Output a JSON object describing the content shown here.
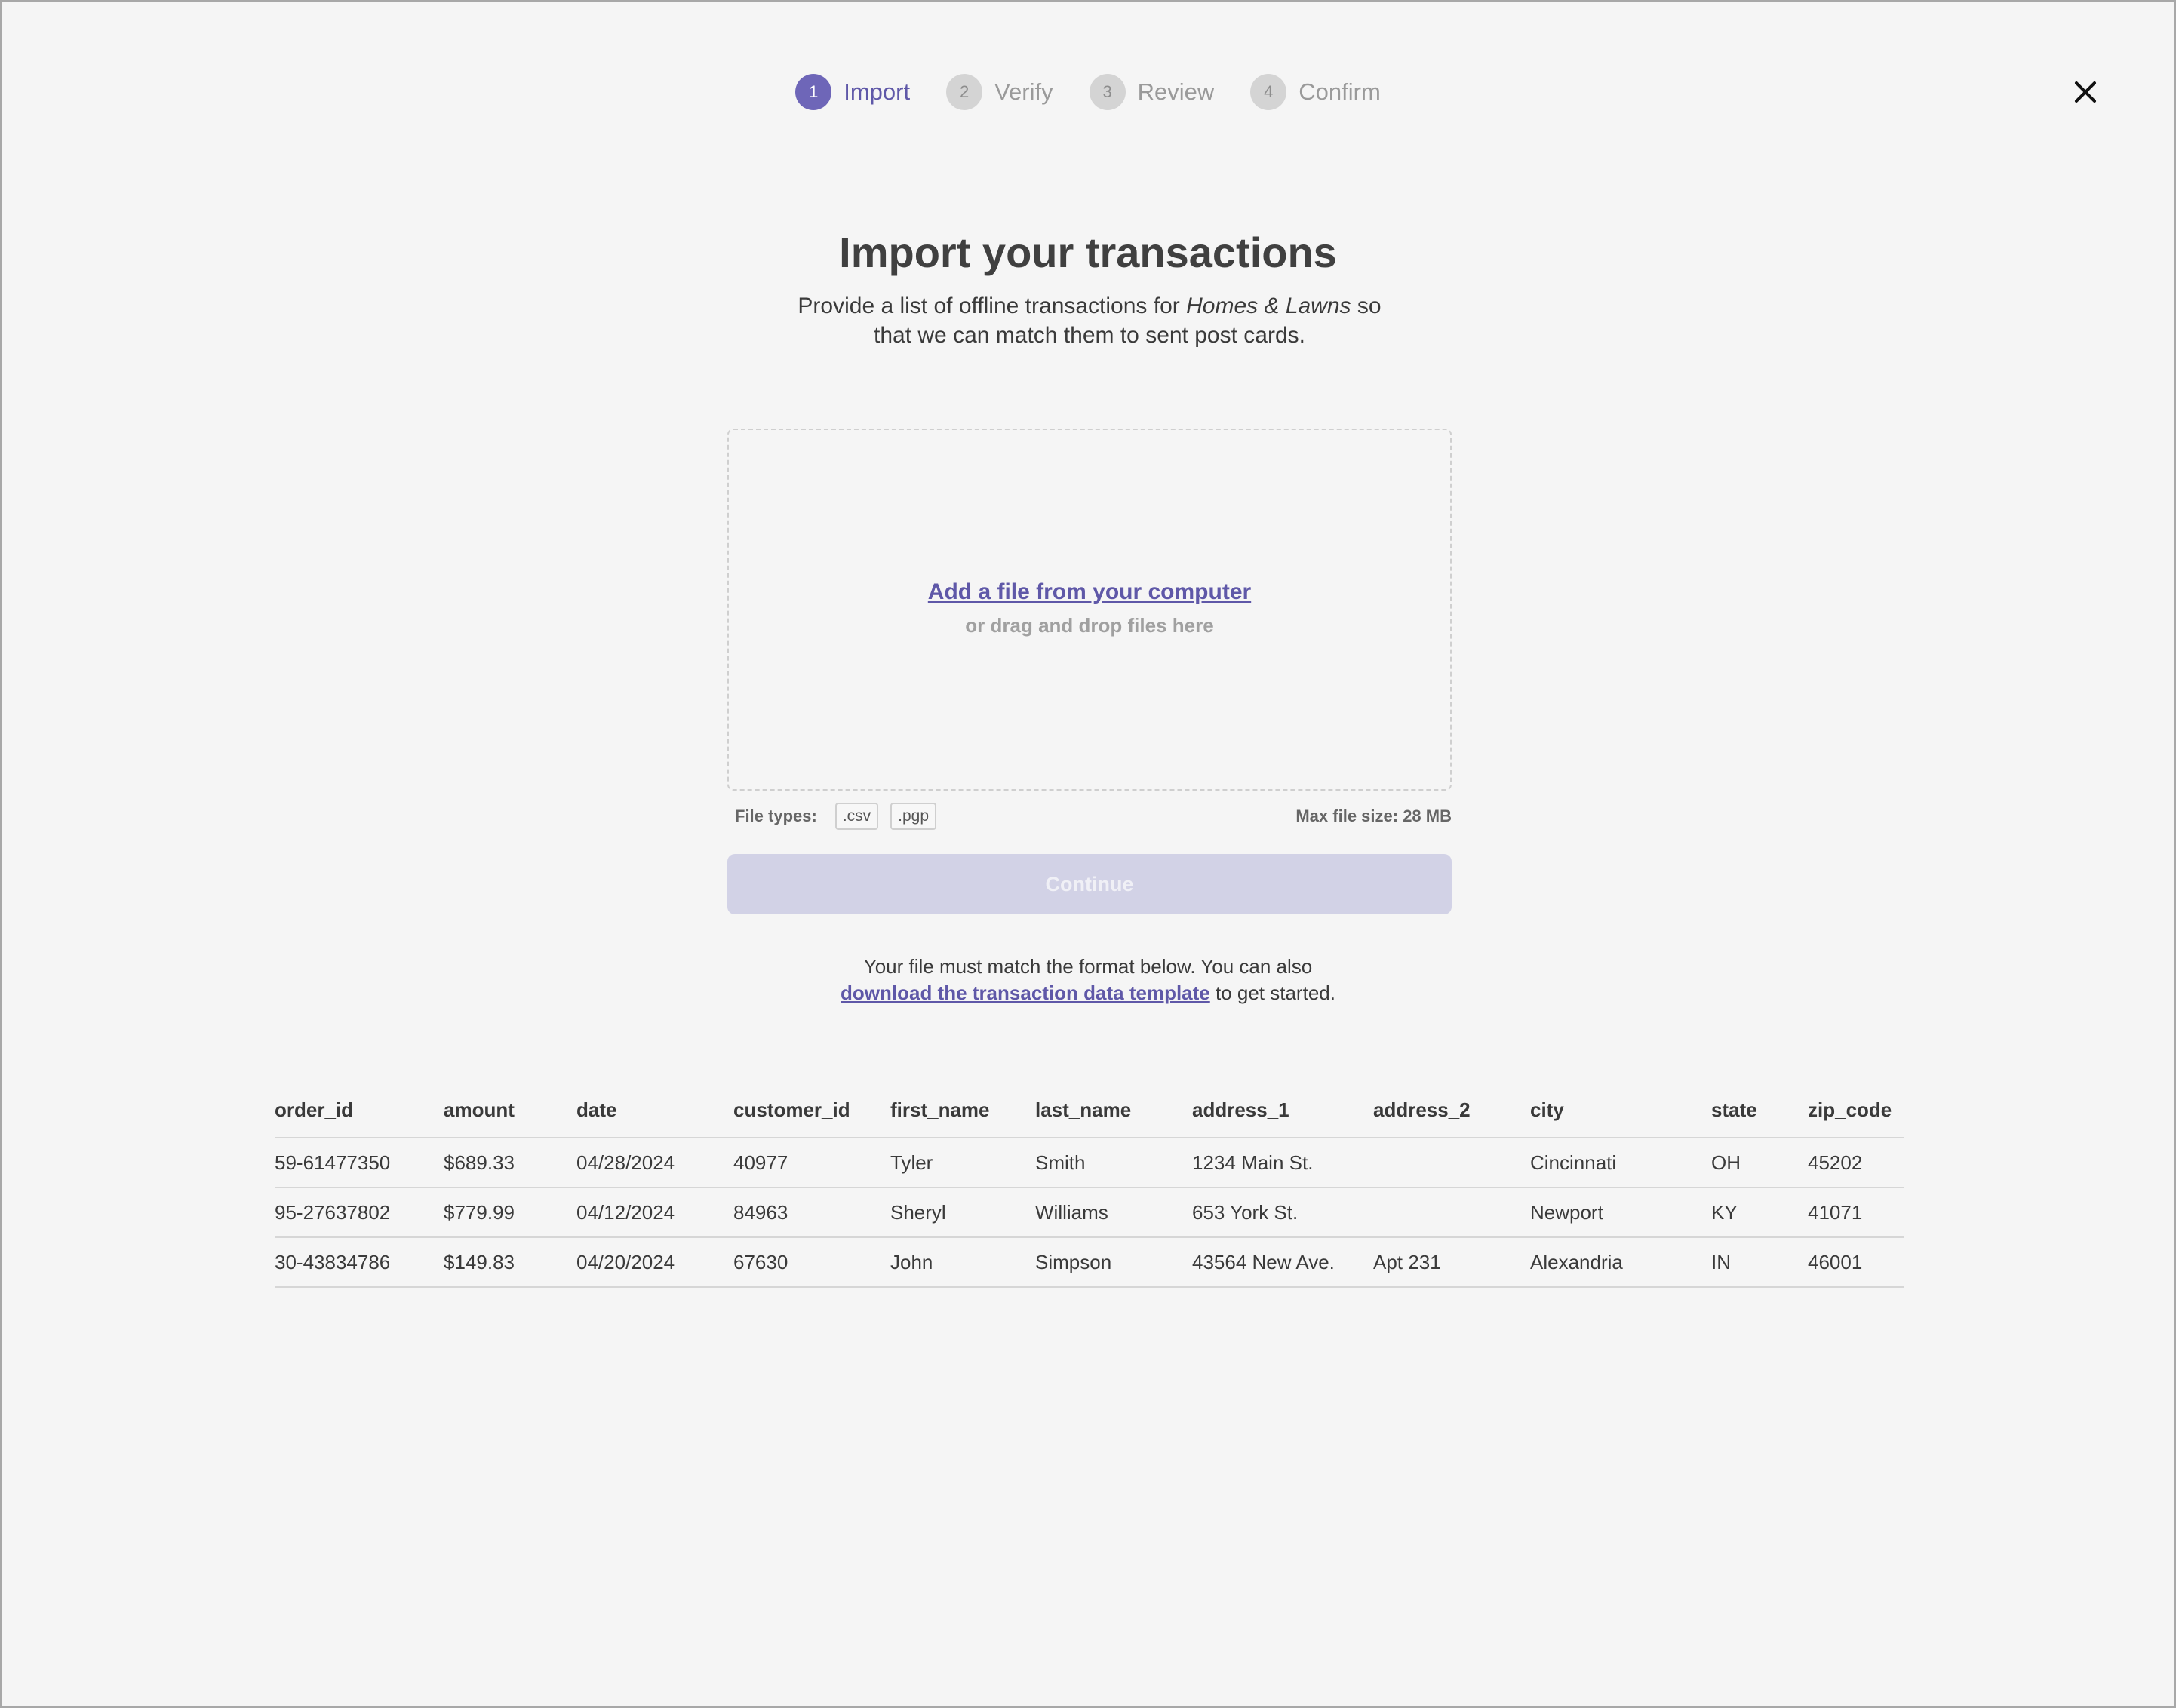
{
  "stepper": {
    "steps": [
      {
        "num": "1",
        "label": "Import"
      },
      {
        "num": "2",
        "label": "Verify"
      },
      {
        "num": "3",
        "label": "Review"
      },
      {
        "num": "4",
        "label": "Confirm"
      }
    ],
    "active_step": "Import"
  },
  "close_icon": "close-icon",
  "heading": {
    "title": "Import your transactions",
    "subtitle_before": "Provide a list of offline transactions for ",
    "subtitle_emphasis": "Homes & Lawns",
    "subtitle_after": " so that we can match them to sent post cards."
  },
  "dropzone": {
    "link": "Add a file from your computer",
    "hint": "or drag and drop files here"
  },
  "filetypes": {
    "label": "File types:",
    "types": [
      ".csv",
      ".pgp"
    ],
    "max_size": "Max file size: 28 MB"
  },
  "continue_label": "Continue",
  "note": {
    "line1": "Your file must match  the format below. You can also",
    "link": "download the transaction data template",
    "after": " to get started."
  },
  "table": {
    "columns": [
      "order_id",
      "amount",
      "date",
      "customer_id",
      "first_name",
      "last_name",
      "address_1",
      "address_2",
      "city",
      "state",
      "zip_code"
    ],
    "rows": [
      [
        "59-61477350",
        "$689.33",
        "04/28/2024",
        "40977",
        "Tyler",
        "Smith",
        "1234 Main St.",
        "",
        "Cincinnati",
        "OH",
        "45202"
      ],
      [
        "95-27637802",
        "$779.99",
        "04/12/2024",
        "84963",
        "Sheryl",
        "Williams",
        "653 York St.",
        "",
        "Newport",
        "KY",
        "41071"
      ],
      [
        "30-43834786",
        "$149.83",
        "04/20/2024",
        "67630",
        "John",
        "Simpson",
        "43564 New Ave.",
        "Apt 231",
        "Alexandria",
        "IN",
        "46001"
      ]
    ]
  },
  "colors": {
    "accent": "#6e66b8",
    "link": "#5f58a8",
    "background": "#f5f5f5",
    "button_disabled": "#d2d2e6"
  }
}
